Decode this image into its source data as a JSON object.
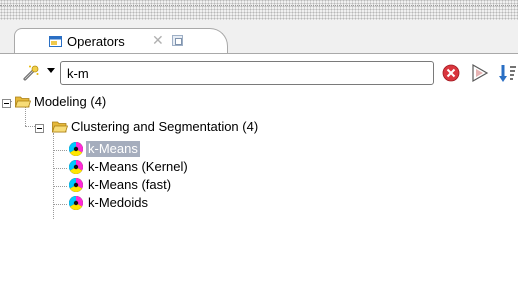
{
  "tab": {
    "label": "Operators",
    "close_glyph": "✕",
    "icon": "operators-view-icon"
  },
  "toolbar": {
    "search_value": "k-m",
    "wand_icon": "new-operator-wand-icon",
    "clear_icon": "clear-search-icon",
    "filter_icon": "filter-icon",
    "sort_icon": "sort-icon"
  },
  "tree": {
    "root": {
      "label": "Modeling (4)",
      "child": {
        "label": "Clustering and Segmentation (4)",
        "operators": [
          {
            "label": "k-Means",
            "selected": true
          },
          {
            "label": "k-Means (Kernel)",
            "selected": false
          },
          {
            "label": "k-Means (fast)",
            "selected": false
          },
          {
            "label": "k-Medoids",
            "selected": false
          }
        ]
      }
    }
  },
  "colors": {
    "selection": "#a5adbd",
    "folder": "#f0c94a",
    "clear_red": "#d9363e"
  }
}
